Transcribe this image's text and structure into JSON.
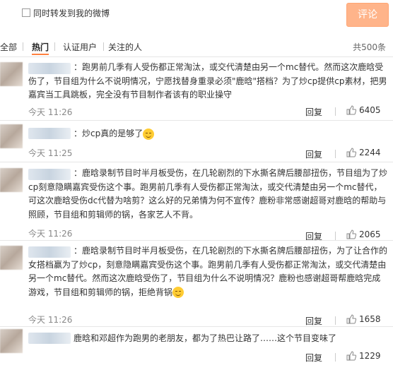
{
  "topbar": {
    "repost_label": "同时转发到我的微博",
    "comment_button": "评论"
  },
  "tabs": {
    "items": [
      {
        "label": "全部"
      },
      {
        "label": "热门"
      },
      {
        "label": "认证用户"
      },
      {
        "label": "关注的人"
      }
    ],
    "total": "共500条"
  },
  "comments": [
    {
      "text": "：跑男前几季有人受伤都正常淘汰，或交代清楚由另一个mc替代。然而这次鹿晗受伤了，节目组为什么不说明情况，宁愿找替身重录必须\"鹿晗\"搭档？为了炒cp提供cp素材，把男嘉宾当工具跳板，完全没有节目制作者该有的职业操守",
      "time": "今天 11:26",
      "reply": "回复",
      "likes": "6405"
    },
    {
      "text": "：炒cp真的是够了",
      "time": "今天 11:25",
      "reply": "回复",
      "likes": "2244"
    },
    {
      "text": "：鹿晗录制节目时半月板受伤，在几轮剧烈的下水撕名牌后腰部扭伤，节目组为了炒cp刻意隐瞒嘉宾受伤这个事。跑男前几季有人受伤都正常淘汰，或交代清楚由另一个mc替代，可这次鹿晗受伤dc代替为啥剪？这么好的兄弟情为何不宣传？鹿粉非常感谢超哥对鹿晗的帮助与照顾，节目组和剪辑师的锅，各家艺人不背。",
      "time": "今天 11:26",
      "reply": "回复",
      "likes": "2065"
    },
    {
      "text": "：鹿晗录制节目时半月板受伤，在几轮剧烈的下水撕名牌后腰部扭伤，为了让合作的女搭档赢为了炒cp，刻意隐瞒嘉宾受伤这个事。跑男前几季有人受伤都正常淘汰，或交代清楚由另一个mc替代。然而这次鹿晗受伤了，节目组为什么不说明情况？鹿粉也感谢超哥帮鹿晗完成游戏，节目组和剪辑师的锅，拒绝背锅",
      "time": "今天 11:26",
      "reply": "回复",
      "likes": "1658"
    },
    {
      "text": "鹿晗和邓超作为跑男的老朋友，都为了热巴让路了……这个节目变味了",
      "time": "",
      "reply": "回复",
      "likes": "1229"
    }
  ]
}
